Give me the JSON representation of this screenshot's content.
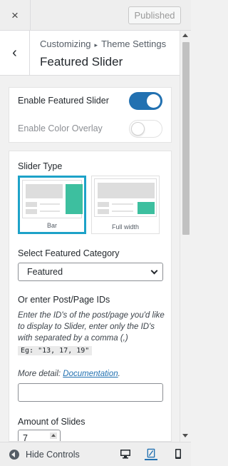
{
  "header": {
    "close_icon": "×",
    "publish_label": "Published"
  },
  "section": {
    "back_icon": "‹",
    "breadcrumb_parent": "Customizing",
    "breadcrumb_sep": "▸",
    "breadcrumb_child": "Theme Settings",
    "title": "Featured Slider"
  },
  "toggles": {
    "enable_slider": {
      "label": "Enable Featured Slider",
      "on": true
    },
    "enable_overlay": {
      "label": "Enable Color Overlay",
      "on": false
    }
  },
  "slider_type": {
    "label": "Slider Type",
    "options": [
      {
        "caption": "Bar",
        "selected": true
      },
      {
        "caption": "Full width",
        "selected": false
      }
    ]
  },
  "category": {
    "label": "Select Featured Category",
    "value": "Featured"
  },
  "post_ids": {
    "label": "Or enter Post/Page IDs",
    "description": "Enter the ID's of the post/page you'd like to display to Slider, enter only the ID's with separated by a comma (,)",
    "example": "Eg: \"13, 17, 19\"",
    "more_detail": "More detail:",
    "link_text": "Documentation",
    "link_suffix": ".",
    "value": ""
  },
  "slides": {
    "label": "Amount of Slides",
    "value": "7"
  },
  "footer": {
    "hide_label": "Hide Controls",
    "devices": [
      "desktop-icon",
      "tablet-icon",
      "mobile-icon"
    ]
  },
  "colors": {
    "accent": "#2271b1",
    "selected_border": "#1da2c8",
    "teal": "#3dbf9f"
  }
}
